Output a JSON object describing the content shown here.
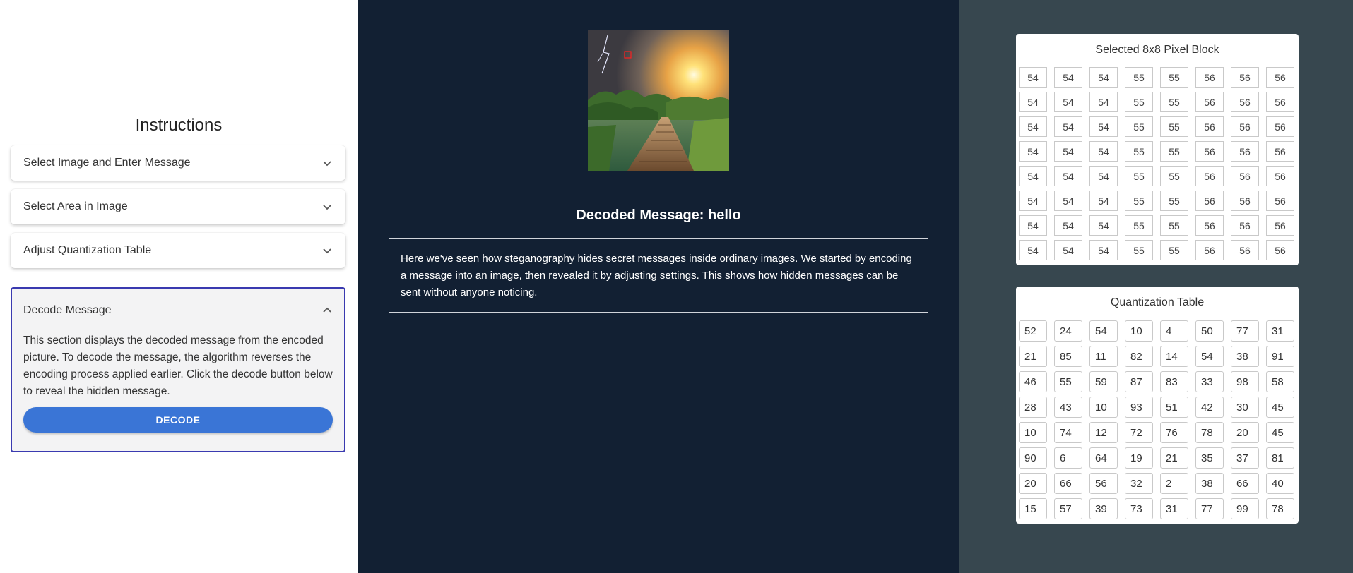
{
  "instructions": {
    "title": "Instructions",
    "sections": [
      {
        "label": "Select Image and Enter Message",
        "expanded": false
      },
      {
        "label": "Select Area in Image",
        "expanded": false
      },
      {
        "label": "Adjust Quantization Table",
        "expanded": false
      },
      {
        "label": "Decode Message",
        "expanded": true,
        "body": "This section displays the decoded message from the encoded picture. To decode the message, the algorithm reverses the encoding process applied earlier. Click the decode button below to reveal the hidden message.",
        "button": "DECODE"
      }
    ]
  },
  "main": {
    "decoded_label": "Decoded Message: hello",
    "explanation": "Here we've seen how steganography hides secret messages inside ordinary images. We started by encoding a message into an image, then revealed it by adjusting settings. This shows how hidden messages can be sent without anyone noticing."
  },
  "pixel_block": {
    "title": "Selected 8x8 Pixel Block",
    "rows": [
      [
        54,
        54,
        54,
        55,
        55,
        56,
        56,
        56
      ],
      [
        54,
        54,
        54,
        55,
        55,
        56,
        56,
        56
      ],
      [
        54,
        54,
        54,
        55,
        55,
        56,
        56,
        56
      ],
      [
        54,
        54,
        54,
        55,
        55,
        56,
        56,
        56
      ],
      [
        54,
        54,
        54,
        55,
        55,
        56,
        56,
        56
      ],
      [
        54,
        54,
        54,
        55,
        55,
        56,
        56,
        56
      ],
      [
        54,
        54,
        54,
        55,
        55,
        56,
        56,
        56
      ],
      [
        54,
        54,
        54,
        55,
        55,
        56,
        56,
        56
      ]
    ]
  },
  "quantization": {
    "title": "Quantization Table",
    "rows": [
      [
        52,
        24,
        54,
        10,
        4,
        50,
        77,
        31
      ],
      [
        21,
        85,
        11,
        82,
        14,
        54,
        38,
        91
      ],
      [
        46,
        55,
        59,
        87,
        83,
        33,
        98,
        58
      ],
      [
        28,
        43,
        10,
        93,
        51,
        42,
        30,
        45
      ],
      [
        10,
        74,
        12,
        72,
        76,
        78,
        20,
        45
      ],
      [
        90,
        6,
        64,
        19,
        21,
        35,
        37,
        81
      ],
      [
        20,
        66,
        56,
        32,
        2,
        38,
        66,
        40
      ],
      [
        15,
        57,
        39,
        73,
        31,
        77,
        99,
        78
      ]
    ]
  },
  "colors": {
    "left_bg": "#ffffff",
    "middle_bg": "#122033",
    "right_bg": "#37474f",
    "accent": "#3a75d6",
    "active_border": "#3a3ab0",
    "selection_marker": "#ff2020"
  },
  "icons": {
    "collapsed": "chevron-down-icon",
    "expanded": "chevron-up-icon"
  }
}
